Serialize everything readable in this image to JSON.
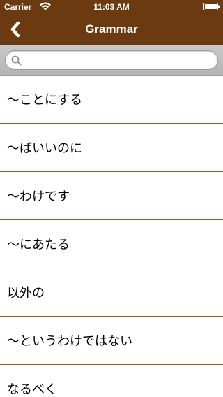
{
  "status": {
    "carrier": "Carrier",
    "time": "11:03 AM"
  },
  "nav": {
    "title": "Grammar",
    "back_icon": "chevron-left-icon"
  },
  "search": {
    "placeholder": "",
    "value": "",
    "icon": "search-icon"
  },
  "items": [
    {
      "label": "〜ことにする"
    },
    {
      "label": "〜ばいいのに"
    },
    {
      "label": "〜わけです"
    },
    {
      "label": "〜にあたる"
    },
    {
      "label": "以外の"
    },
    {
      "label": "〜というわけではない"
    },
    {
      "label": "なるべく"
    }
  ],
  "colors": {
    "bar_background": "#6b3a10",
    "separator": "#8a5a28",
    "search_background": "#c0c0c0"
  }
}
